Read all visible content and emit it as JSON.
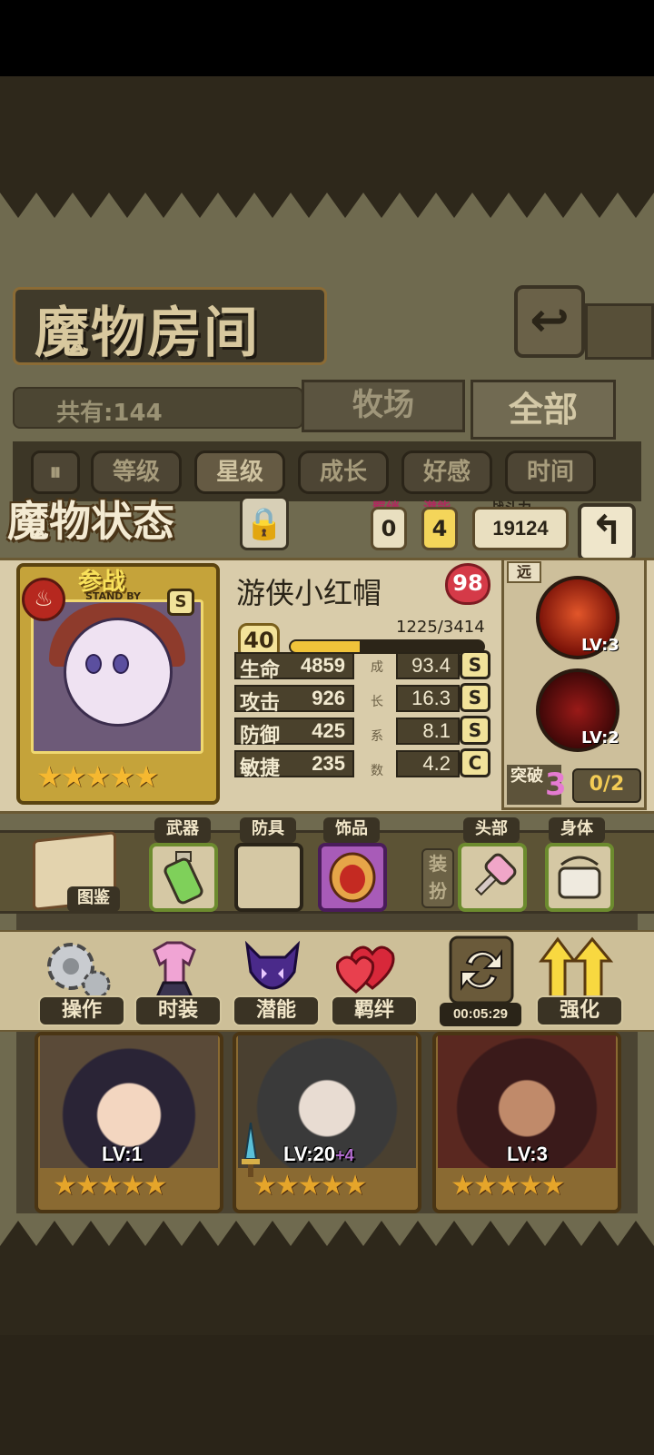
{
  "header": {
    "title": "魔物房间",
    "total_count": "共有:144",
    "tabs": [
      {
        "label": "牧场",
        "active": false
      },
      {
        "label": "全部",
        "active": true
      }
    ],
    "filters": [
      "等级",
      "星级",
      "成长",
      "好感",
      "时间"
    ],
    "selected_filter": "星级"
  },
  "status_panel": {
    "title": "魔物状态",
    "bond_label": "羁绊",
    "bond_value": "0",
    "potential_label": "潜能",
    "potential_value": "4",
    "power_label": "战斗力",
    "power_value": "19124"
  },
  "monster": {
    "name": "游侠小红帽",
    "affection": "98",
    "standby_label": "参战",
    "standby_sub": "STAND BY",
    "rank": "S",
    "stars": "★★★★★",
    "level": "40",
    "exp_text": "1225/3414",
    "exp_progress": 0.359,
    "growth_label": [
      "成",
      "长",
      "系",
      "数"
    ],
    "stats": [
      {
        "name": "生命",
        "value": "4859",
        "growth": "93.4",
        "grade": "S"
      },
      {
        "name": "攻击",
        "value": "926",
        "growth": "16.3",
        "grade": "S"
      },
      {
        "name": "防御",
        "value": "425",
        "growth": "8.1",
        "grade": "S"
      },
      {
        "name": "敏捷",
        "value": "235",
        "growth": "4.2",
        "grade": "C"
      }
    ]
  },
  "skills": {
    "range_tag": "远",
    "list": [
      {
        "icon": "triple-arrow-skill-icon",
        "level": "LV:3"
      },
      {
        "icon": "blood-orb-skill-icon",
        "level": "LV:2"
      }
    ],
    "breakthrough_label": "突破",
    "breakthrough_level": "3",
    "breakthrough_progress": "0/2"
  },
  "equipment": {
    "codex_label": "图鉴",
    "dress_label": "装扮",
    "slots": [
      {
        "label": "武器",
        "item": "green-potion-icon"
      },
      {
        "label": "防具",
        "item": ""
      },
      {
        "label": "饰品",
        "item": "red-amulet-icon"
      },
      {
        "label": "头部",
        "item": "pink-hammer-icon"
      },
      {
        "label": "身体",
        "item": "white-bag-icon"
      }
    ]
  },
  "actions": [
    {
      "label": "操作",
      "icon": "gear-icon"
    },
    {
      "label": "时装",
      "icon": "outfit-icon"
    },
    {
      "label": "潜能",
      "icon": "shadow-demon-icon"
    },
    {
      "label": "羁绊",
      "icon": "hearts-icon"
    },
    {
      "label": "",
      "icon": "refresh-icon",
      "timer": "00:05:29"
    },
    {
      "label": "强化",
      "icon": "upgrade-arrows-icon"
    }
  ],
  "monster_list": [
    {
      "level": "LV:1",
      "plus": "",
      "stars": "★★★★★"
    },
    {
      "level": "LV:20",
      "plus": "+4",
      "stars": "★★★★★"
    },
    {
      "level": "LV:3",
      "plus": "",
      "stars": "★★★★★"
    }
  ],
  "colors": {
    "parchment": "#6f6a4f",
    "panel": "#d9ccaa",
    "gold": "#c5a33a",
    "heart": "#d53a48",
    "exp": "#f0c33a",
    "breakthrough": "#e57bd1"
  }
}
